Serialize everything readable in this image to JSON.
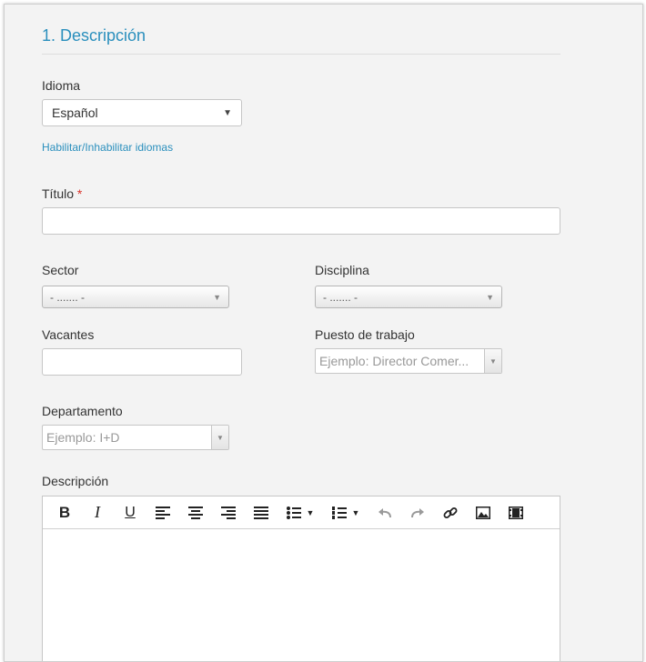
{
  "section": {
    "title": "1. Descripción"
  },
  "idioma": {
    "label": "Idioma",
    "selected": "Español",
    "toggle_link": "Habilitar/Inhabilitar idiomas"
  },
  "titulo": {
    "label": "Título",
    "required_mark": "*",
    "value": ""
  },
  "sector": {
    "label": "Sector",
    "selected": "- ....... -"
  },
  "disciplina": {
    "label": "Disciplina",
    "selected": "- ....... -"
  },
  "vacantes": {
    "label": "Vacantes",
    "value": ""
  },
  "puesto": {
    "label": "Puesto de trabajo",
    "placeholder": "Ejemplo: Director Comer..."
  },
  "departamento": {
    "label": "Departamento",
    "placeholder": "Ejemplo: I+D"
  },
  "descripcion": {
    "label": "Descripción",
    "toolbar": [
      "bold-icon",
      "italic-icon",
      "underline-icon",
      "align-left-icon",
      "align-center-icon",
      "align-right-icon",
      "justify-icon",
      "bullet-list-icon",
      "numbered-list-icon",
      "undo-icon",
      "redo-icon",
      "link-icon",
      "image-icon",
      "video-icon"
    ]
  },
  "colors": {
    "accent": "#2a8fbd",
    "required": "#d9332b",
    "background": "#f3f3f3"
  }
}
